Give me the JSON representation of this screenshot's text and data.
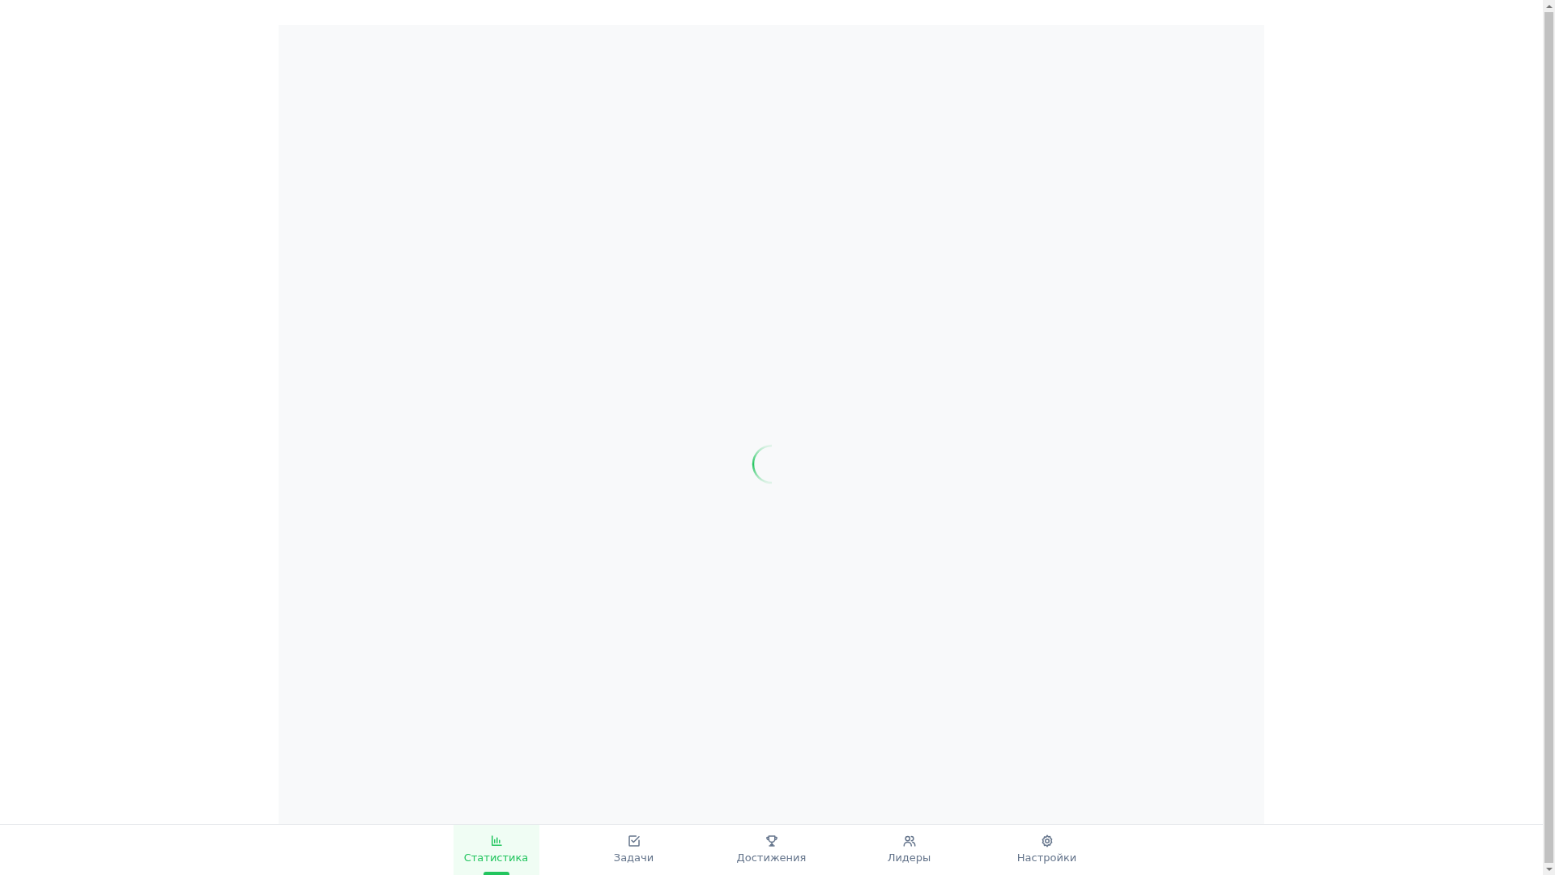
{
  "content": {
    "loading": true
  },
  "nav": [
    {
      "label": "Статистика",
      "selected": true
    },
    {
      "label": "Задачи",
      "selected": false
    },
    {
      "label": "Достижения",
      "selected": false
    },
    {
      "label": "Лидеры",
      "selected": false
    },
    {
      "label": "Настройки",
      "selected": false
    }
  ]
}
